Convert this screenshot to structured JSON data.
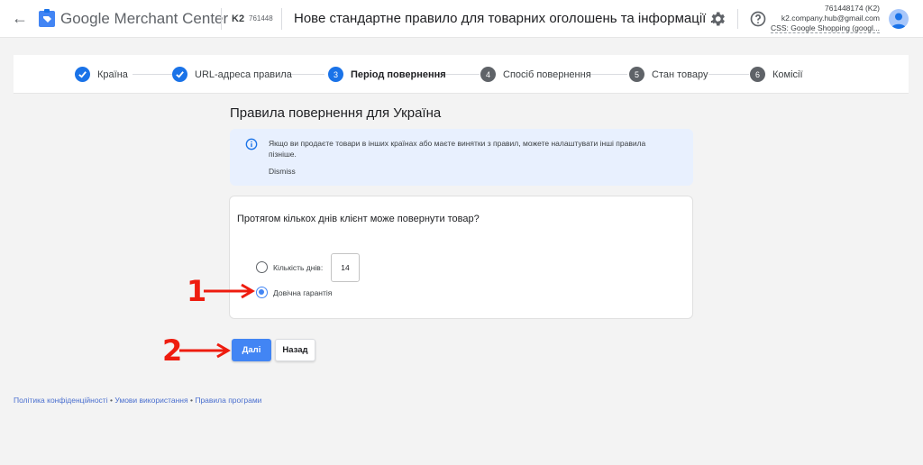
{
  "header": {
    "back_label": "←",
    "brand": "Google Merchant Center",
    "account_short": "K2",
    "account_id_short": "761448",
    "title": "Нове стандартне правило для товарних оголошень та інформації ...",
    "account_line1": "761448174 (K2)",
    "account_email": "k2.company.hub@gmail.com",
    "account_css": "CSS: Google Shopping (googl..."
  },
  "stepper": {
    "steps": [
      {
        "label": "Країна",
        "state": "done",
        "number": "1"
      },
      {
        "label": "URL-адреса правила",
        "state": "done",
        "number": "2"
      },
      {
        "label": "Період повернення",
        "state": "active",
        "number": "3"
      },
      {
        "label": "Спосіб повернення",
        "state": "pending",
        "number": "4"
      },
      {
        "label": "Стан товару",
        "state": "pending",
        "number": "5"
      },
      {
        "label": "Комісії",
        "state": "pending",
        "number": "6"
      }
    ],
    "colors": {
      "done": "#1a73e8",
      "active": "#1a73e8",
      "pending": "#5f6368"
    }
  },
  "main": {
    "section_title": "Правила повернення для Україна",
    "info": {
      "text": "Якщо ви продаєте товари в інших країнах або маєте винятки з правил, можете налаштувати інші правила пізніше.",
      "dismiss": "Dismiss"
    },
    "card": {
      "question": "Протягом кількох днів клієнт може повернути товар?",
      "option_days_label": "Кількість днів:",
      "days_value": "14",
      "option_lifetime_label": "Довічна гарантія",
      "selected": "lifetime"
    },
    "buttons": {
      "next": "Далі",
      "back": "Назад"
    },
    "annotations": {
      "one": "1",
      "two": "2"
    }
  },
  "footer": {
    "links": [
      "Політика конфіденційності",
      "Умови використання",
      "Правила програми"
    ],
    "separator": "•"
  }
}
